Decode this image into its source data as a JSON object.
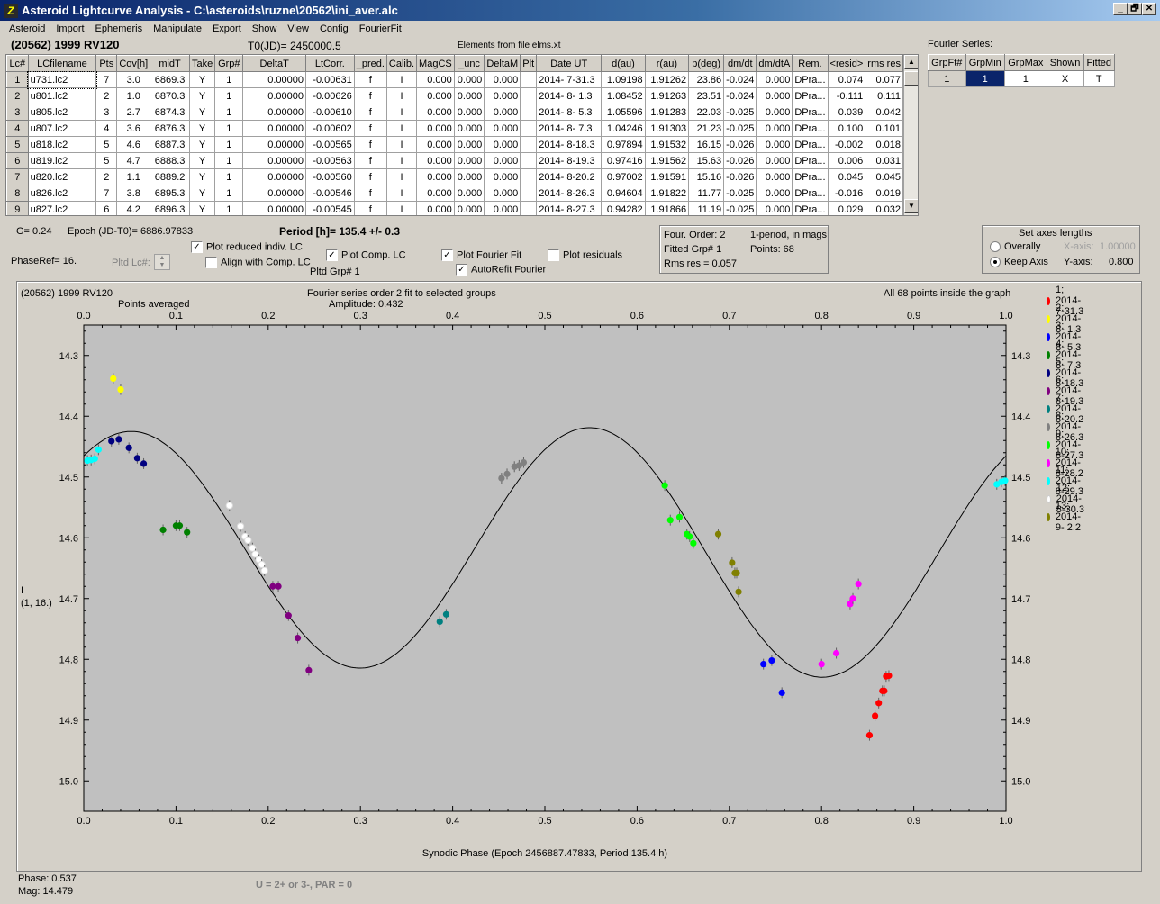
{
  "window": {
    "title": "Asteroid Lightcurve Analysis - C:\\asteroids\\ruzne\\20562\\ini_aver.alc",
    "icon": "app-icon",
    "btn_min": "_",
    "btn_max": "🗗",
    "btn_close": "✕"
  },
  "menu": [
    "Asteroid",
    "Import",
    "Ephemeris",
    "Manipulate",
    "Export",
    "Show",
    "View",
    "Config",
    "FourierFit"
  ],
  "header": {
    "asteroid": "(20562) 1999 RV120",
    "t0": "T0(JD)= 2450000.5",
    "elements": "Elements from file elms.xt"
  },
  "table": {
    "columns": [
      "Lc#",
      "LCfilename",
      "Pts",
      "Cov[h]",
      "midT",
      "Take",
      "Grp#",
      "DeltaT",
      "LtCorr.",
      "_pred.",
      "Calib.",
      "MagCS",
      "_unc",
      "DeltaM",
      "Plt",
      "Date UT",
      "d(au)",
      "r(au)",
      "p(deg)",
      "dm/dt",
      "dm/dtA",
      "Rem.",
      "<resid>",
      "rms res"
    ],
    "rows": [
      [
        "1",
        "u731.lc2",
        "7",
        "3.0",
        "6869.3",
        "Y",
        "1",
        "0.00000",
        "-0.00631",
        "f",
        "I",
        "0.000",
        "0.000",
        "0.000",
        "",
        "2014- 7-31.3",
        "1.09198",
        "1.91262",
        "23.86",
        "-0.024",
        "0.000",
        "DPra...",
        "0.074",
        "0.077"
      ],
      [
        "2",
        "u801.lc2",
        "2",
        "1.0",
        "6870.3",
        "Y",
        "1",
        "0.00000",
        "-0.00626",
        "f",
        "I",
        "0.000",
        "0.000",
        "0.000",
        "",
        "2014- 8- 1.3",
        "1.08452",
        "1.91263",
        "23.51",
        "-0.024",
        "0.000",
        "DPra...",
        "-0.111",
        "0.111"
      ],
      [
        "3",
        "u805.lc2",
        "3",
        "2.7",
        "6874.3",
        "Y",
        "1",
        "0.00000",
        "-0.00610",
        "f",
        "I",
        "0.000",
        "0.000",
        "0.000",
        "",
        "2014- 8- 5.3",
        "1.05596",
        "1.91283",
        "22.03",
        "-0.025",
        "0.000",
        "DPra...",
        "0.039",
        "0.042"
      ],
      [
        "4",
        "u807.lc2",
        "4",
        "3.6",
        "6876.3",
        "Y",
        "1",
        "0.00000",
        "-0.00602",
        "f",
        "I",
        "0.000",
        "0.000",
        "0.000",
        "",
        "2014- 8- 7.3",
        "1.04246",
        "1.91303",
        "21.23",
        "-0.025",
        "0.000",
        "DPra...",
        "0.100",
        "0.101"
      ],
      [
        "5",
        "u818.lc2",
        "5",
        "4.6",
        "6887.3",
        "Y",
        "1",
        "0.00000",
        "-0.00565",
        "f",
        "I",
        "0.000",
        "0.000",
        "0.000",
        "",
        "2014- 8-18.3",
        "0.97894",
        "1.91532",
        "16.15",
        "-0.026",
        "0.000",
        "DPra...",
        "-0.002",
        "0.018"
      ],
      [
        "6",
        "u819.lc2",
        "5",
        "4.7",
        "6888.3",
        "Y",
        "1",
        "0.00000",
        "-0.00563",
        "f",
        "I",
        "0.000",
        "0.000",
        "0.000",
        "",
        "2014- 8-19.3",
        "0.97416",
        "1.91562",
        "15.63",
        "-0.026",
        "0.000",
        "DPra...",
        "0.006",
        "0.031"
      ],
      [
        "7",
        "u820.lc2",
        "2",
        "1.1",
        "6889.2",
        "Y",
        "1",
        "0.00000",
        "-0.00560",
        "f",
        "I",
        "0.000",
        "0.000",
        "0.000",
        "",
        "2014- 8-20.2",
        "0.97002",
        "1.91591",
        "15.16",
        "-0.026",
        "0.000",
        "DPra...",
        "0.045",
        "0.045"
      ],
      [
        "8",
        "u826.lc2",
        "7",
        "3.8",
        "6895.3",
        "Y",
        "1",
        "0.00000",
        "-0.00546",
        "f",
        "I",
        "0.000",
        "0.000",
        "0.000",
        "",
        "2014- 8-26.3",
        "0.94604",
        "1.91822",
        "11.77",
        "-0.025",
        "0.000",
        "DPra...",
        "-0.016",
        "0.019"
      ],
      [
        "9",
        "u827.lc2",
        "6",
        "4.2",
        "6896.3",
        "Y",
        "1",
        "0.00000",
        "-0.00545",
        "f",
        "I",
        "0.000",
        "0.000",
        "0.000",
        "",
        "2014- 8-27.3",
        "0.94282",
        "1.91866",
        "11.19",
        "-0.025",
        "0.000",
        "DPra...",
        "0.029",
        "0.032"
      ]
    ]
  },
  "fourier_table": {
    "label": "Fourier Series:",
    "columns": [
      "GrpFt#",
      "GrpMin",
      "GrpMax",
      "Shown",
      "Fitted"
    ],
    "row": [
      "1",
      "1",
      "1",
      "X",
      "T"
    ]
  },
  "controls": {
    "g": "G= 0.24",
    "epoch": "Epoch (JD-T0)= 6886.97833",
    "period": "Period [h]= 135.4 +/- 0.3",
    "phaseref": "PhaseRef= 16.",
    "pltd_lc": "Pltd Lc#:",
    "plot_reduced": "Plot reduced indiv. LC",
    "align": "Align with Comp. LC",
    "plot_comp": "Plot Comp. LC",
    "pltd_grp": "Pltd Grp#  1",
    "plot_fourier": "Plot Fourier Fit",
    "autorefit": "AutoRefit Fourier",
    "plot_resid": "Plot residuals",
    "info": {
      "four_order": "Four. Order:  2",
      "one_period": "1-period, in mags",
      "fitted": "Fitted Grp# 1",
      "points": "Points: 68",
      "rms": "Rms res      = 0.057"
    },
    "axes": {
      "title": "Set axes lengths",
      "overally": "Overally",
      "keep": "Keep Axis",
      "xaxis": "X-axis:",
      "xval": "1.00000",
      "yaxis": "Y-axis:",
      "yval": "0.800"
    }
  },
  "chart_data": {
    "type": "scatter",
    "title": "Fourier series order 2 fit to selected groups",
    "subtitle": "Amplitude: 0.432",
    "top_left": "(20562) 1999 RV120",
    "top_left2": "Points averaged",
    "top_right": "All 68 points inside the graph",
    "xlabel": "Synodic Phase (Epoch 2456887.47833, Period 135.4 h)",
    "ylabel": "I",
    "ylabel2": "(1, 16.)",
    "xlim": [
      0,
      1
    ],
    "ylim": [
      15.05,
      14.25
    ],
    "y_inverted": true,
    "grid": false,
    "xticks": [
      "0.0",
      "0.1",
      "0.2",
      "0.3",
      "0.4",
      "0.5",
      "0.6",
      "0.7",
      "0.8",
      "0.9",
      "1.0"
    ],
    "yticks": [
      "14.3",
      "14.4",
      "14.5",
      "14.6",
      "14.7",
      "14.8",
      "14.9",
      "15.0"
    ],
    "fourier_curve": {
      "mean": 14.622,
      "a1": 0.0,
      "b1": 0.0,
      "period_fraction": "two maxima near phase 0.06 and 0.55",
      "maxima": [
        [
          0.06,
          14.455
        ],
        [
          0.55,
          14.407
        ]
      ],
      "minima": [
        [
          0.3,
          14.803
        ],
        [
          0.8,
          14.838
        ]
      ]
    },
    "series": [
      {
        "name": "1; 2014- 7-31.3",
        "color": "#ff0000",
        "points": [
          [
            0.852,
            14.925
          ],
          [
            0.858,
            14.893
          ],
          [
            0.862,
            14.872
          ],
          [
            0.866,
            14.852
          ],
          [
            0.868,
            14.852
          ],
          [
            0.87,
            14.828
          ],
          [
            0.873,
            14.827
          ]
        ]
      },
      {
        "name": "2; 2014- 8- 1.3",
        "color": "#ffff00",
        "points": [
          [
            0.032,
            14.338
          ],
          [
            0.04,
            14.356
          ]
        ]
      },
      {
        "name": "3; 2014- 8- 5.3",
        "color": "#0000ff",
        "points": [
          [
            0.737,
            14.808
          ],
          [
            0.746,
            14.802
          ],
          [
            0.757,
            14.855
          ]
        ]
      },
      {
        "name": "4; 2014- 8- 7.3",
        "color": "#008000",
        "points": [
          [
            0.086,
            14.587
          ],
          [
            0.1,
            14.58
          ],
          [
            0.104,
            14.58
          ],
          [
            0.112,
            14.591
          ]
        ]
      },
      {
        "name": "5; 2014- 8-18.3",
        "color": "#000080",
        "points": [
          [
            0.03,
            14.441
          ],
          [
            0.038,
            14.438
          ],
          [
            0.049,
            14.452
          ],
          [
            0.058,
            14.469
          ],
          [
            0.065,
            14.478
          ]
        ]
      },
      {
        "name": "6; 2014- 8-19.3",
        "color": "#800080",
        "points": [
          [
            0.205,
            14.68
          ],
          [
            0.211,
            14.68
          ],
          [
            0.222,
            14.728
          ],
          [
            0.232,
            14.765
          ],
          [
            0.244,
            14.818
          ]
        ]
      },
      {
        "name": "7; 2014- 8-20.2",
        "color": "#008080",
        "points": [
          [
            0.386,
            14.738
          ],
          [
            0.393,
            14.726
          ]
        ]
      },
      {
        "name": "8; 2014- 8-26.3",
        "color": "#808080",
        "points": [
          [
            0.453,
            14.502
          ],
          [
            0.459,
            14.495
          ],
          [
            0.467,
            14.483
          ],
          [
            0.472,
            14.481
          ],
          [
            0.477,
            14.476
          ]
        ]
      },
      {
        "name": "9; 2014- 8-27.3",
        "color": "#00ff00",
        "points": [
          [
            0.63,
            14.514
          ],
          [
            0.636,
            14.571
          ],
          [
            0.646,
            14.566
          ],
          [
            0.654,
            14.594
          ],
          [
            0.657,
            14.598
          ],
          [
            0.661,
            14.609
          ]
        ]
      },
      {
        "name": "10; 2014- 8-28.2",
        "color": "#ff00ff",
        "points": [
          [
            0.8,
            14.808
          ],
          [
            0.816,
            14.79
          ],
          [
            0.831,
            14.709
          ],
          [
            0.834,
            14.7
          ],
          [
            0.84,
            14.676
          ]
        ]
      },
      {
        "name": "11; 2014- 8-29.3",
        "color": "#00ffff",
        "points": [
          [
            0.004,
            14.473
          ],
          [
            0.008,
            14.472
          ],
          [
            0.012,
            14.47
          ],
          [
            0.016,
            14.455
          ],
          [
            0.99,
            14.512
          ],
          [
            0.995,
            14.508
          ],
          [
            0.999,
            14.506
          ]
        ]
      },
      {
        "name": "12; 2014- 8-30.3",
        "color": "#ffffff",
        "points": [
          [
            0.158,
            14.547
          ],
          [
            0.17,
            14.581
          ],
          [
            0.175,
            14.598
          ],
          [
            0.178,
            14.604
          ],
          [
            0.183,
            14.617
          ],
          [
            0.186,
            14.627
          ],
          [
            0.19,
            14.636
          ],
          [
            0.193,
            14.644
          ],
          [
            0.196,
            14.654
          ]
        ]
      },
      {
        "name": "13; 2014- 9- 2.2",
        "color": "#808000",
        "points": [
          [
            0.688,
            14.594
          ],
          [
            0.703,
            14.641
          ],
          [
            0.706,
            14.658
          ],
          [
            0.708,
            14.658
          ],
          [
            0.71,
            14.689
          ]
        ]
      }
    ]
  },
  "status": {
    "phase": "Phase:  0.537",
    "mag": "Mag:   14.479",
    "formula": "U = 2+ or 3-, PAR = 0"
  }
}
